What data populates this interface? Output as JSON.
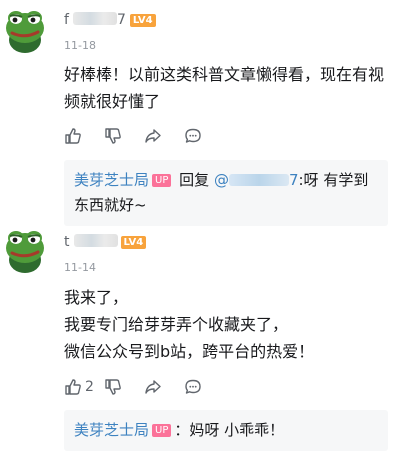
{
  "comments": [
    {
      "username_visible": "f",
      "username_suffix": "7",
      "level": "LV4",
      "date": "11-18",
      "lines": [
        "好棒棒！以前这类科普文章懒得看，现在有视",
        "频就很好懂了"
      ],
      "actions": {
        "like_count": "",
        "dislike": "",
        "share": "",
        "reply": ""
      },
      "reply": {
        "author": "美芽芝士局",
        "badge": "UP",
        "action_word": "回复",
        "mention_prefix": "@",
        "mention_suffix": "7",
        "line1_text": ":呀 有学到",
        "line2_text": "东西就好~"
      }
    },
    {
      "username_visible": "t",
      "username_suffix": "",
      "level": "LV4",
      "date": "11-14",
      "lines": [
        "我来了，",
        "我要专门给芽芽弄个收藏夹了，",
        "微信公众号到b站，跨平台的热爱！"
      ],
      "actions": {
        "like_count": "2"
      },
      "reply": {
        "author": "美芽芝士局",
        "badge": "UP",
        "text": "：妈呀 小乖乖！"
      }
    }
  ],
  "colors": {
    "level_badge": "#f8a33c",
    "up_badge": "#fb7299",
    "link": "#3d82c0",
    "reply_bg": "#f6f7f8"
  },
  "icons": [
    "frog-avatar-icon",
    "thumbs-up-icon",
    "thumbs-down-icon",
    "share-icon",
    "comment-icon"
  ]
}
